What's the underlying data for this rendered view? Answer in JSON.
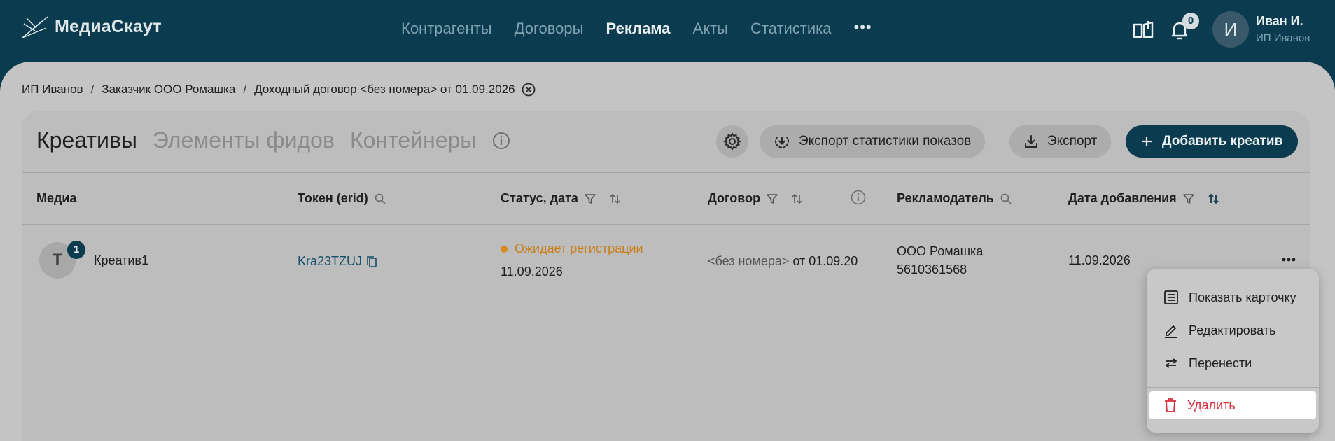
{
  "app": {
    "name": "МедиаСкаут"
  },
  "nav": {
    "items": [
      "Контрагенты",
      "Договоры",
      "Реклама",
      "Акты",
      "Статистика"
    ],
    "active": "Реклама",
    "more": "•••"
  },
  "header": {
    "notification_count": "0",
    "user_initial": "И",
    "user_name": "Иван И.",
    "user_org": "ИП Иванов"
  },
  "breadcrumb": [
    "ИП Иванов",
    "Заказчик ООО Ромашка",
    "Доходный договор <без номера> от 01.09.2026"
  ],
  "tabs": [
    "Креативы",
    "Элементы фидов",
    "Контейнеры"
  ],
  "toolbar": {
    "export_stats": "Экспорт статистики показов",
    "export": "Экспорт",
    "add_creative": "Добавить креатив"
  },
  "table": {
    "columns": {
      "media": "Медиа",
      "token": "Токен (erid)",
      "status": "Статус, дата",
      "contract": "Договор",
      "advertiser": "Рекламодатель",
      "date_added": "Дата добавления"
    },
    "row": {
      "avatar": "Т",
      "avatar_count": "1",
      "name": "Креатив1",
      "token": "Kra23TZUJ",
      "status": "Ожидает регистрации",
      "status_date": "11.09.2026",
      "contract_prefix": "<без номера>",
      "contract_suffix": "от 01.09.20",
      "advertiser_name": "ООО Ромашка",
      "advertiser_inn": "5610361568",
      "date_added": "11.09.2026"
    }
  },
  "context_menu": {
    "show_card": "Показать карточку",
    "edit": "Редактировать",
    "move": "Перенести",
    "delete": "Удалить"
  },
  "colors": {
    "brand": "#0a3b4f",
    "status_pending": "#d88a1e",
    "danger": "#d9323e"
  }
}
